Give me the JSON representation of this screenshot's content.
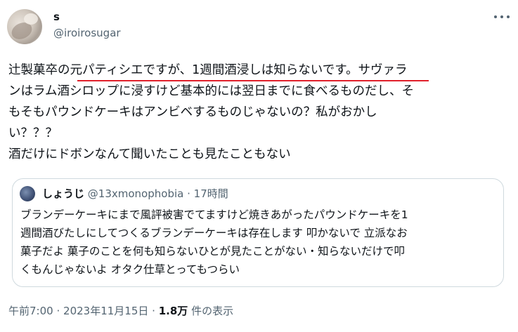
{
  "author": {
    "name": "s",
    "handle": "@iroirosugar"
  },
  "tweet": {
    "lines": [
      "辻製菓卒の元パティシエですが、1週間酒浸しは知らないです。サヴァラ",
      "ンはラム酒シロップに浸すけど基本的には翌日までに食べるものだし、そ",
      "もそもパウンドケーキはアンビベするものじゃないの？私がおかし",
      "い？？？",
      "酒だけにドボンなんて聞いたことも見たこともない"
    ]
  },
  "quote": {
    "name": "しょうじ",
    "handle": "@13xmonophobia",
    "separator": "·",
    "time": "17時間",
    "lines": [
      "ブランデーケーキにまで風評被害でてますけど焼きあがったパウンドケーキを1",
      "週間酒びたしにしてつくるブランデーケーキは存在します 叩かないで 立派なお",
      "菓子だよ 菓子のことを何も知らないひとが見たことがない・知らないだけで叩",
      "くもんじゃないよ オタク仕草とってもつらい"
    ]
  },
  "footer": {
    "time": "午前7:00",
    "sep": "·",
    "date": "2023年11月15日",
    "sep2": "·",
    "views": "1.8万",
    "views_label": "件の表示"
  },
  "icons": {
    "more": "more-horizontal-icon",
    "underline_color": "#e0202a"
  }
}
